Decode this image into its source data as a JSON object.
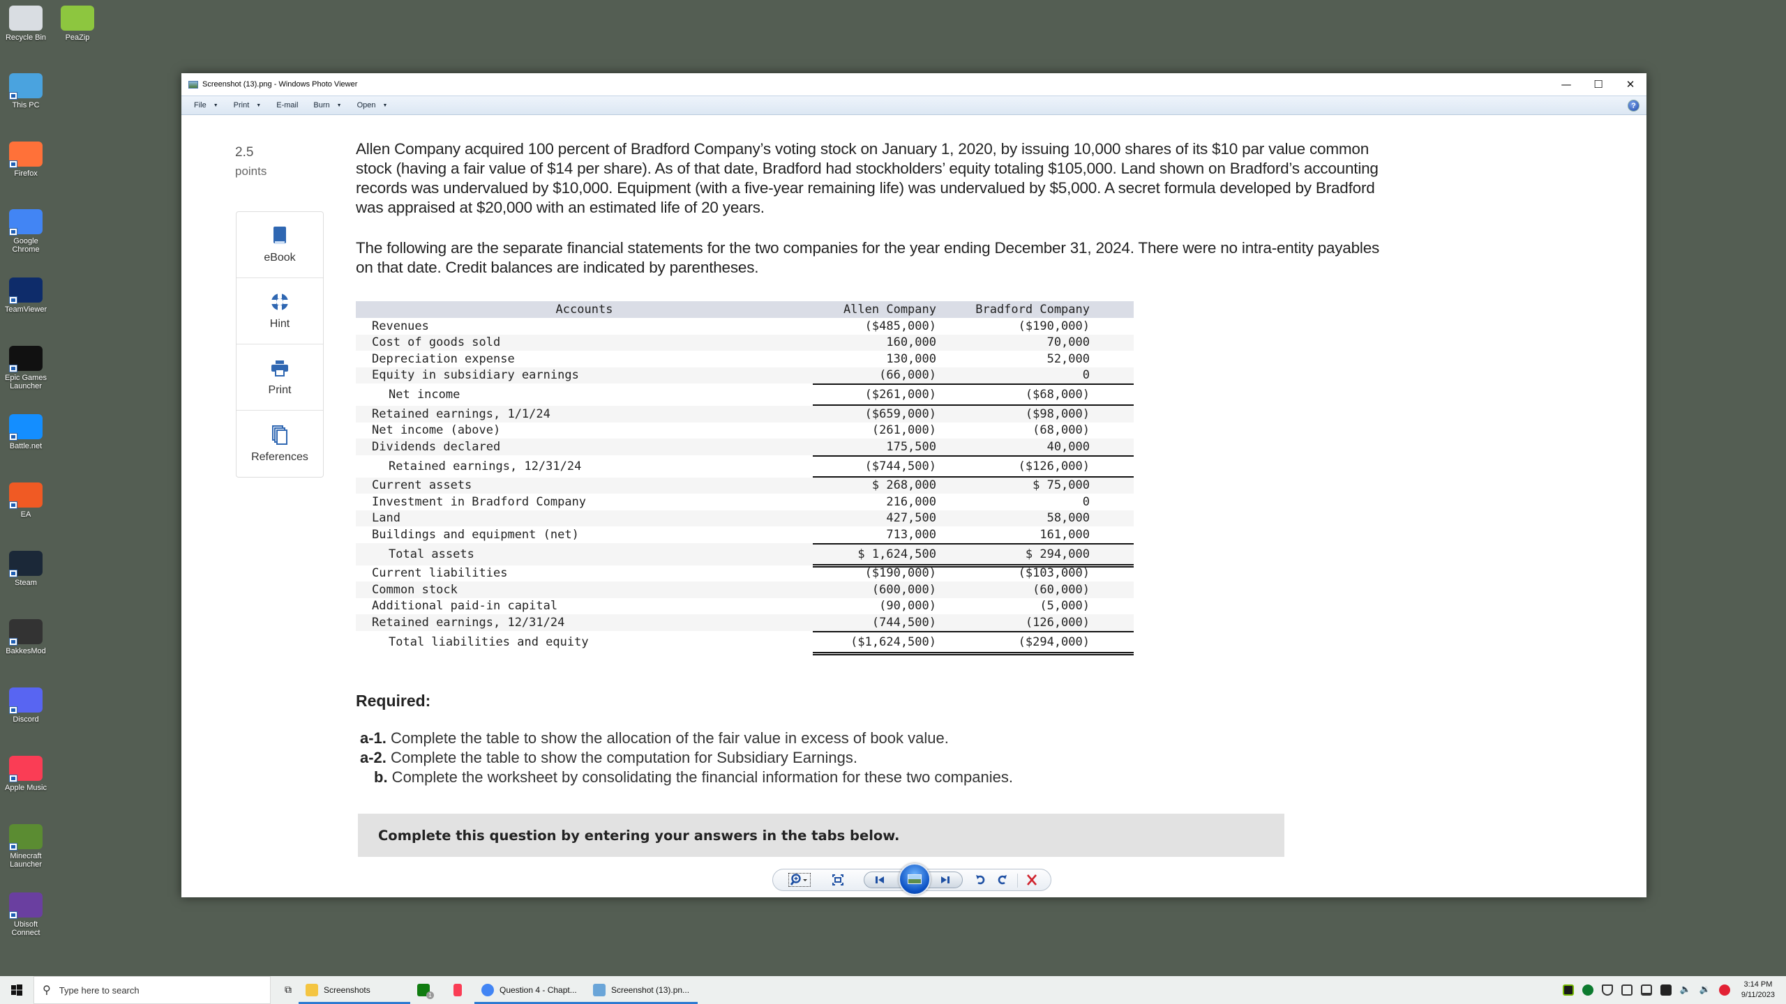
{
  "desktop": {
    "icons": [
      {
        "label": "Recycle Bin",
        "icon": "recycle-bin-icon",
        "color": "#d9dde2"
      },
      {
        "label": "PeaZip",
        "icon": "peazip-icon",
        "color": "#8dc63f"
      },
      {
        "label": "This PC",
        "icon": "computer-icon",
        "color": "#4aa3df"
      },
      {
        "label": "Firefox",
        "icon": "firefox-icon",
        "color": "#ff7139"
      },
      {
        "label": "Google Chrome",
        "icon": "chrome-icon",
        "color": "#4285f4"
      },
      {
        "label": "TeamViewer",
        "icon": "teamviewer-icon",
        "color": "#0e2c6a"
      },
      {
        "label": "Epic Games Launcher",
        "icon": "epic-games-icon",
        "color": "#111111"
      },
      {
        "label": "Battle.net",
        "icon": "battlenet-icon",
        "color": "#148eff"
      },
      {
        "label": "EA",
        "icon": "ea-icon",
        "color": "#f05a24"
      },
      {
        "label": "Steam",
        "icon": "steam-icon",
        "color": "#1b2838"
      },
      {
        "label": "BakkesMod",
        "icon": "bakkesmod-icon",
        "color": "#333333"
      },
      {
        "label": "Discord",
        "icon": "discord-icon",
        "color": "#5865f2"
      },
      {
        "label": "Apple Music",
        "icon": "apple-music-icon",
        "color": "#fa3d55"
      },
      {
        "label": "Minecraft Launcher",
        "icon": "minecraft-icon",
        "color": "#5b8c32"
      },
      {
        "label": "Ubisoft Connect",
        "icon": "ubisoft-icon",
        "color": "#6a3fa0"
      }
    ]
  },
  "window": {
    "title": "Screenshot (13).png - Windows Photo Viewer",
    "controls": {
      "minimize": "—",
      "maximize": "☐",
      "close": "✕"
    },
    "menu": [
      {
        "label": "File",
        "dropdown": true
      },
      {
        "label": "Print",
        "dropdown": true
      },
      {
        "label": "E-mail",
        "dropdown": false
      },
      {
        "label": "Burn",
        "dropdown": true
      },
      {
        "label": "Open",
        "dropdown": true
      }
    ],
    "help": "?"
  },
  "question": {
    "points_value": "2.5",
    "points_label": "points",
    "tools": [
      {
        "label": "eBook",
        "icon": "book-icon"
      },
      {
        "label": "Hint",
        "icon": "lifebuoy-icon"
      },
      {
        "label": "Print",
        "icon": "printer-icon"
      },
      {
        "label": "References",
        "icon": "documents-icon"
      }
    ],
    "paragraph1": "Allen Company acquired 100 percent of Bradford Company’s voting stock on January 1, 2020, by issuing 10,000 shares of its $10 par value common stock (having a fair value of $14 per share). As of that date, Bradford had stockholders’ equity totaling $105,000. Land shown on Bradford’s accounting records was undervalued by $10,000. Equipment (with a five-year remaining life) was undervalued by $5,000. A secret formula developed by Bradford was appraised at $20,000 with an estimated life of 20 years.",
    "paragraph2": "The following are the separate financial statements for the two companies for the year ending December 31, 2024. There were no intra-entity payables on that date. Credit balances are indicated by parentheses.",
    "table": {
      "headers": {
        "accounts": "Accounts",
        "allen": "Allen Company",
        "bradford": "Bradford Company"
      },
      "rows": [
        {
          "account": "Revenues",
          "allen": "($485,000)",
          "bradford": "($190,000)"
        },
        {
          "account": "Cost of goods sold",
          "allen": "160,000",
          "bradford": "70,000"
        },
        {
          "account": "Depreciation expense",
          "allen": "130,000",
          "bradford": "52,000"
        },
        {
          "account": "Equity in subsidiary earnings",
          "allen": "(66,000)",
          "bradford": "0"
        },
        {
          "account": "Net income",
          "allen": "($261,000)",
          "bradford": "($68,000)",
          "total": true
        },
        {
          "account": "Retained earnings, 1/1/24",
          "allen": "($659,000)",
          "bradford": "($98,000)"
        },
        {
          "account": "Net income (above)",
          "allen": "(261,000)",
          "bradford": "(68,000)"
        },
        {
          "account": "Dividends declared",
          "allen": "175,500",
          "bradford": "40,000"
        },
        {
          "account": "Retained earnings, 12/31/24",
          "allen": "($744,500)",
          "bradford": "($126,000)",
          "total": true
        },
        {
          "account": "Current assets",
          "allen": "$ 268,000",
          "bradford": "$ 75,000"
        },
        {
          "account": "Investment in Bradford Company",
          "allen": "216,000",
          "bradford": "0"
        },
        {
          "account": "Land",
          "allen": "427,500",
          "bradford": "58,000"
        },
        {
          "account": "Buildings and equipment (net)",
          "allen": "713,000",
          "bradford": "161,000"
        },
        {
          "account": "Total assets",
          "allen": "$ 1,624,500",
          "bradford": "$ 294,000",
          "total": true
        },
        {
          "account": "Current liabilities",
          "allen": "($190,000)",
          "bradford": "($103,000)"
        },
        {
          "account": "Common stock",
          "allen": "(600,000)",
          "bradford": "(60,000)"
        },
        {
          "account": "Additional paid-in capital",
          "allen": "(90,000)",
          "bradford": "(5,000)"
        },
        {
          "account": "Retained earnings, 12/31/24",
          "allen": "(744,500)",
          "bradford": "(126,000)"
        },
        {
          "account": "Total liabilities and equity",
          "allen": "($1,624,500)",
          "bradford": "($294,000)",
          "total": true
        }
      ]
    },
    "required_heading": "Required:",
    "requirements": [
      {
        "tag": "a-1.",
        "text": " Complete the table to show the allocation of the fair value in excess of book value."
      },
      {
        "tag": "a-2.",
        "text": " Complete the table to show the computation for Subsidiary Earnings."
      },
      {
        "tag": "b.",
        "text": " Complete the worksheet by consolidating the financial information for these two companies."
      }
    ],
    "banner": "Complete this question by entering your answers in the tabs below."
  },
  "viewer_controls": {
    "zoom": "zoom-icon",
    "actual_size": "fit-to-window-icon",
    "previous": "previous-icon",
    "slideshow": "slideshow-icon",
    "next": "next-icon",
    "rotate_ccw": "rotate-counterclockwise-icon",
    "rotate_cw": "rotate-clockwise-icon",
    "delete": "delete-icon"
  },
  "taskbar": {
    "search_placeholder": "Type here to search",
    "items": [
      {
        "label": "Screenshots",
        "icon": "folder-icon",
        "active": true
      },
      {
        "label": "",
        "icon": "xbox-icon",
        "badge": "1"
      },
      {
        "label": "",
        "icon": "apple-music-icon"
      },
      {
        "label": "Question 4 - Chapt...",
        "icon": "chrome-icon",
        "active": true
      },
      {
        "label": "Screenshot (13).pn...",
        "icon": "photo-viewer-icon",
        "active": true
      }
    ],
    "time": "3:14 PM",
    "date": "9/11/2023"
  }
}
